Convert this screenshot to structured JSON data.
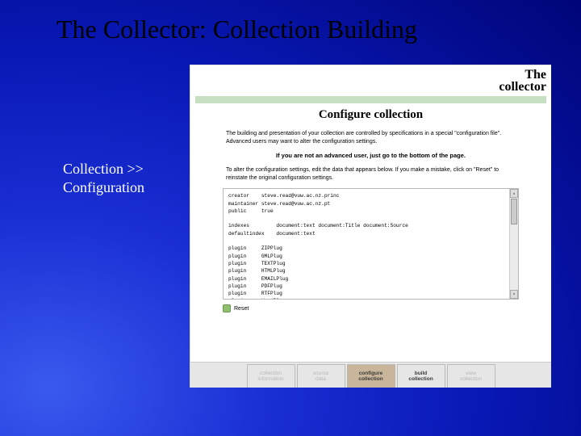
{
  "slide": {
    "title": "The Collector: Collection Building",
    "caption_l1": "Collection >>",
    "caption_l2": "Configuration"
  },
  "app": {
    "logo_l1": "The",
    "logo_l2": "collector",
    "heading": "Configure collection",
    "intro": "The building and presentation of your collection are controlled by specifications in a special \"configuration file\". Advanced users may want to alter the configuration settings.",
    "not_advanced": "If you are not an advanced user, just go to the bottom of the page.",
    "alter": "To alter the configuration settings, edit the data that appears below. If you make a mistake, click on \"Reset\" to reinstate the original configuration settings.",
    "config_text": "creator    steve.read@vuw.ac.nz.princ\nmaintainer steve.read@vuw.ac.nz.pt\npublic     true\n\nindexes         document:text document:Title document:Source\ndefaultindex    document:text\n\nplugin     ZIPPlug\nplugin     GMLPlug\nplugin     TEXTPlug\nplugin     HTMLPlug\nplugin     EMAILPlug\nplugin     PDFPlug\nplugin     RTFPlug\nplugin     WordPlug\nplugin     PSPlug\nplugin     ArcPlug",
    "reset_label": "Reset",
    "nav": {
      "t1a": "collection",
      "t1b": "information",
      "t2a": "source",
      "t2b": "data",
      "t3a": "configure",
      "t3b": "collection",
      "t4a": "build",
      "t4b": "collection",
      "t5a": "view",
      "t5b": "collection"
    }
  }
}
